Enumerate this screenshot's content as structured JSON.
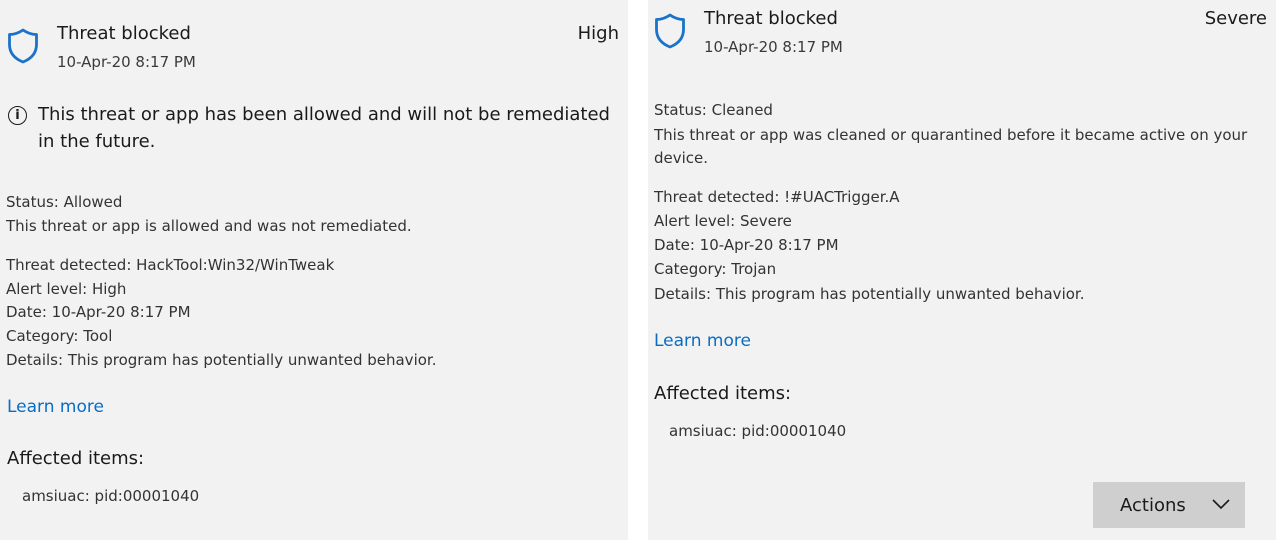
{
  "left": {
    "title": "Threat blocked",
    "date": "10-Apr-20 8:17 PM",
    "severity": "High",
    "notice": "This threat or app has been allowed and will not be remediated in the future.",
    "status": "Status:  Allowed",
    "status_desc": "This threat or app is allowed and was not remediated.",
    "details": [
      "Threat detected: HackTool:Win32/WinTweak",
      "Alert level: High",
      "Date:  10-Apr-20 8:17 PM",
      "Category:  Tool",
      "Details:  This program has potentially unwanted behavior."
    ],
    "learn_more": "Learn more",
    "affected_heading": "Affected items:",
    "affected_item": "amsiuac: pid:00001040"
  },
  "right": {
    "title": "Threat blocked",
    "date": "10-Apr-20 8:17 PM",
    "severity": "Severe",
    "status": "Status:  Cleaned",
    "status_desc_1": "This threat or app was cleaned or quarantined before it became active on your",
    "status_desc_2": "device.",
    "details": [
      "Threat detected: !#UACTrigger.A",
      "Alert level: Severe",
      "Date:  10-Apr-20 8:17 PM",
      "Category:  Trojan",
      "Details:  This program has potentially unwanted behavior."
    ],
    "learn_more": "Learn more",
    "affected_heading": "Affected items:",
    "affected_item": "amsiuac: pid:00001040",
    "actions_label": "Actions"
  },
  "icons": {
    "shield": "shield-icon",
    "info": "info-icon",
    "chevron": "chevron-down-icon"
  },
  "colors": {
    "shield_blue": "#1a73c8",
    "link_blue": "#0a6dc2",
    "panel_bg": "#f2f2f2",
    "button_bg": "#cfcfcf"
  }
}
